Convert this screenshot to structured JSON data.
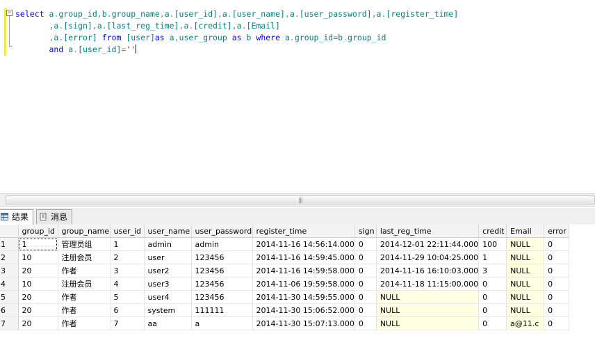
{
  "editor": {
    "lines": [
      "select a.group_id,b.group_name,a.[user_id],a.[user_name],a.[user_password],a.[register_time]",
      "       ,a.[sign],a.[last_reg_time],a.[credit],a.[Email]",
      "       ,a.[error] from [user]as a,user_group as b where a.group_id=b.group_id",
      "       and a.[user_id]=''"
    ]
  },
  "tabs": [
    {
      "label": "结果",
      "icon": "grid-icon"
    },
    {
      "label": "消息",
      "icon": "message-icon"
    }
  ],
  "grid": {
    "columns": [
      "group_id",
      "group_name",
      "user_id",
      "user_name",
      "user_password",
      "register_time",
      "sign",
      "last_reg_time",
      "credit",
      "Email",
      "error"
    ],
    "rows": [
      [
        "1",
        "1",
        "管理员组",
        "1",
        "admin",
        "admin",
        "2014-11-16 14:56:14.000",
        "0",
        "2014-12-01 22:11:44.000",
        "100",
        "NULL",
        "0"
      ],
      [
        "2",
        "10",
        "注册会员",
        "2",
        "user",
        "123456",
        "2014-11-16 14:59:45.000",
        "0",
        "2014-11-29 10:04:25.000",
        "1",
        "NULL",
        "0"
      ],
      [
        "3",
        "20",
        "作者",
        "3",
        "user2",
        "123456",
        "2014-11-16 14:59:58.000",
        "0",
        "2014-11-16 16:10:03.000",
        "3",
        "NULL",
        "0"
      ],
      [
        "4",
        "10",
        "注册会员",
        "4",
        "user3",
        "123456",
        "2014-11-06 19:59:58.000",
        "0",
        "2014-11-18 11:15:00.000",
        "0",
        "NULL",
        "0"
      ],
      [
        "5",
        "20",
        "作者",
        "5",
        "user4",
        "123456",
        "2014-11-30 14:59:55.000",
        "0",
        "NULL",
        "0",
        "NULL",
        "0"
      ],
      [
        "6",
        "20",
        "作者",
        "6",
        "system",
        "111111",
        "2014-11-30 15:06:52.000",
        "0",
        "NULL",
        "0",
        "NULL",
        "0"
      ],
      [
        "7",
        "20",
        "作者",
        "7",
        "aa",
        "a",
        "2014-11-30 15:07:13.000",
        "0",
        "NULL",
        "0",
        "a@11.c",
        "0"
      ]
    ]
  }
}
